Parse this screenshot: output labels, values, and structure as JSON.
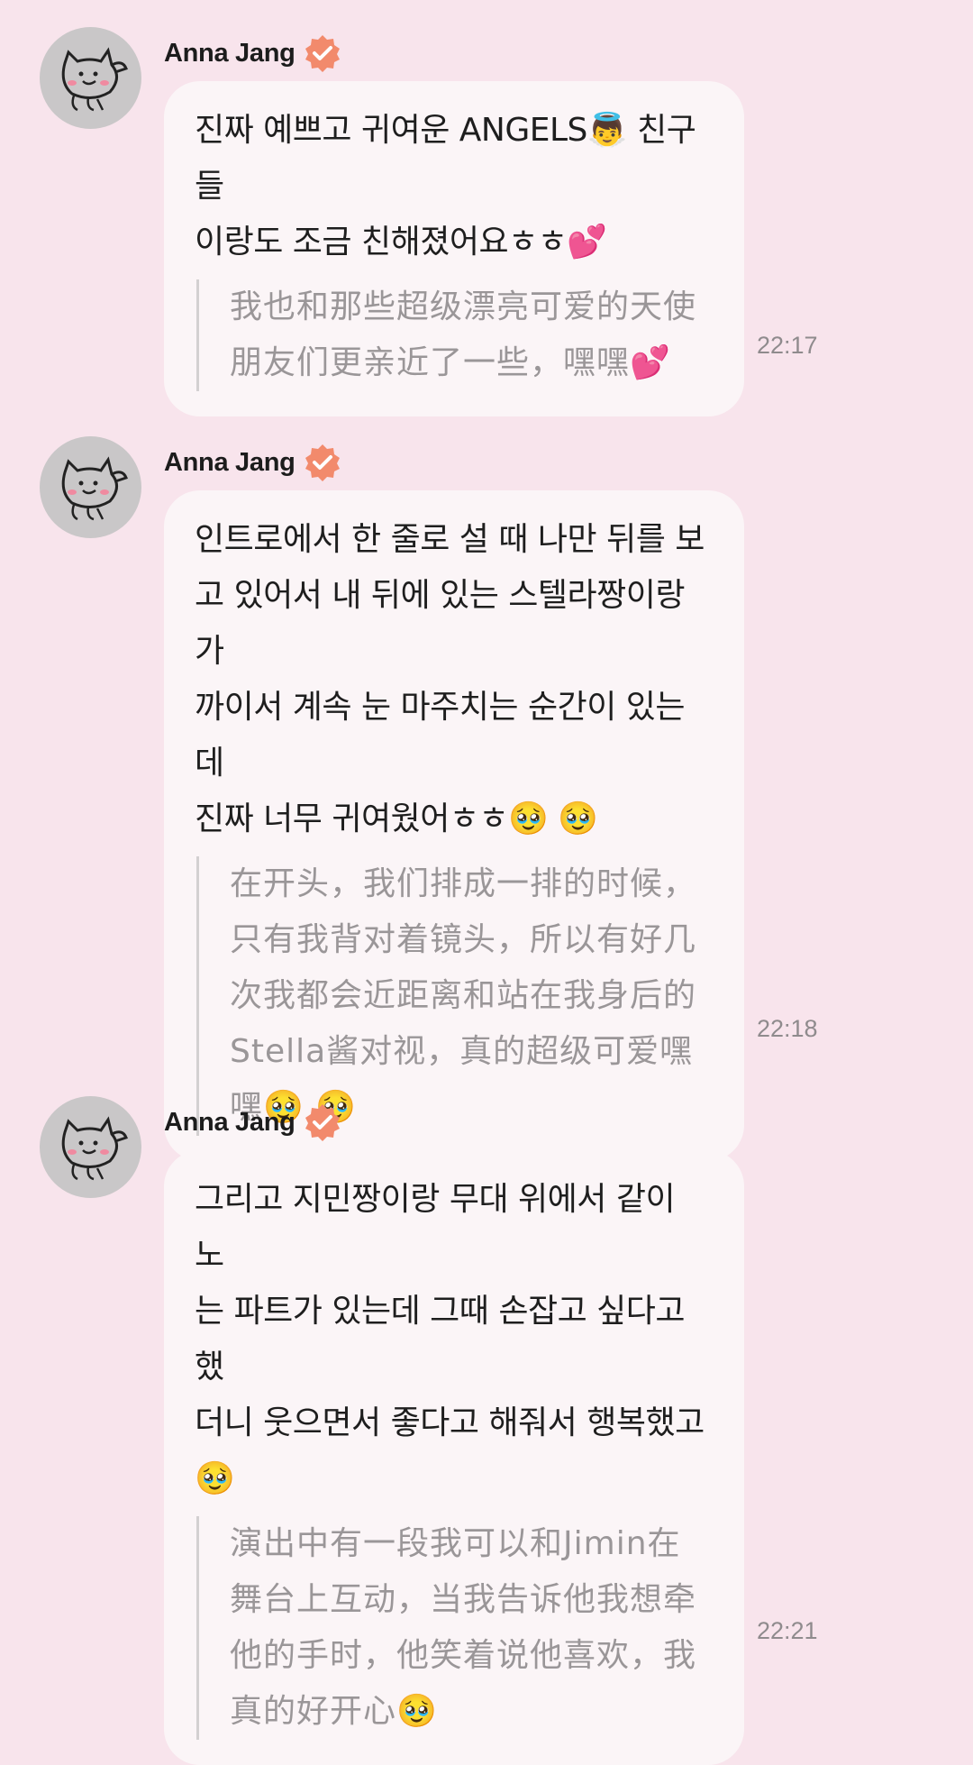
{
  "messages": [
    {
      "sender": "Anna Jang",
      "verified": true,
      "korean": "진짜 예쁘고 귀여운 ANGELS👼 친구들\n이랑도 조금 친해졌어요ㅎㅎ💕",
      "chinese": "我也和那些超级漂亮可爱的天使\n朋友们更亲近了一些，嘿嘿💕",
      "time": "22:17"
    },
    {
      "sender": "Anna Jang",
      "verified": true,
      "korean": "인트로에서 한 줄로 설 때 나만 뒤를 보\n고 있어서 내 뒤에 있는 스텔라짱이랑 가\n까이서 계속 눈 마주치는 순간이 있는데\n진짜 너무 귀여웠어ㅎㅎ🥹 🥹",
      "chinese": "在开头，我们排成一排的时候，\n只有我背对着镜头，所以有好几\n次我都会近距离和站在我身后的\nStella酱对视，真的超级可爱嘿\n嘿🥹 🥹",
      "time": "22:18"
    },
    {
      "sender": "Anna Jang",
      "verified": true,
      "korean": "그리고 지민짱이랑 무대 위에서 같이 노\n는 파트가 있는데 그때 손잡고 싶다고 했\n더니 웃으면서 좋다고 해줘서 행복했고\n🥹",
      "chinese": "演出中有一段我可以和Jimin在\n舞台上互动，当我告诉他我想牵\n他的手时，他笑着说他喜欢，我\n真的好开心🥹",
      "time": "22:21"
    }
  ],
  "colors": {
    "background": "#f8e4ec",
    "bubble": "#fbf5f7",
    "verified_badge": "#f28a6c",
    "avatar_bg": "#c9c7c8"
  },
  "icons": {
    "avatar": "cat-doodle-avatar",
    "verified": "verified-badge-icon"
  }
}
